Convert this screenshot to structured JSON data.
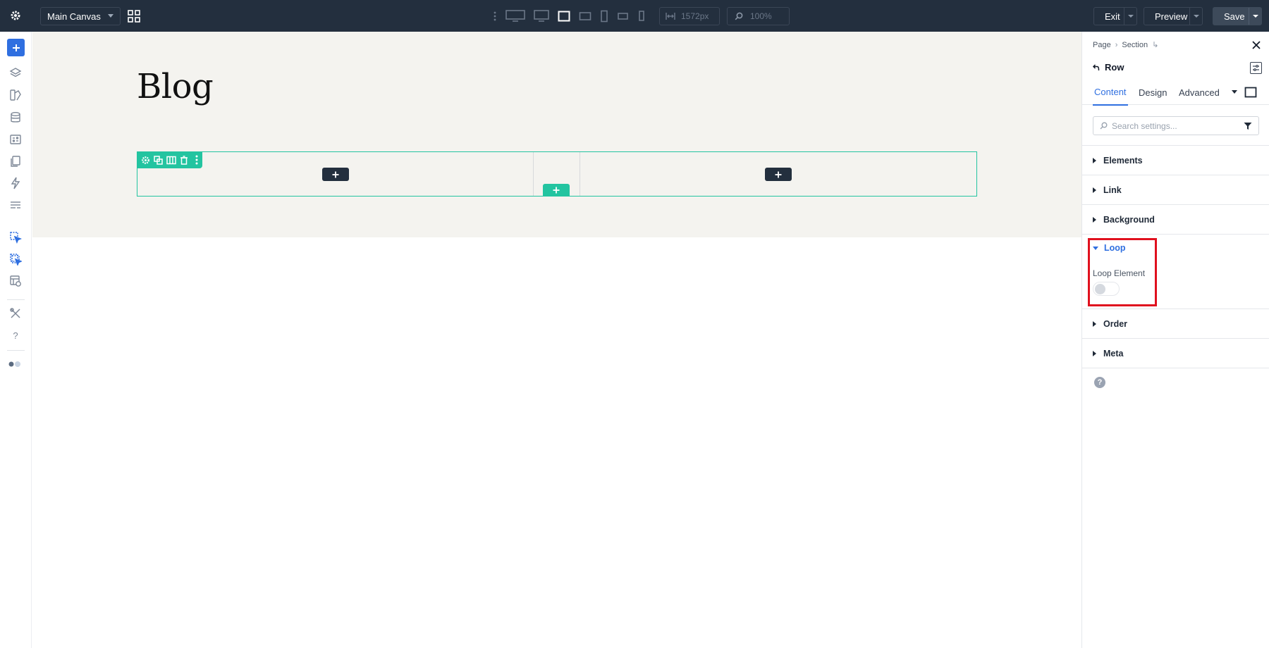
{
  "topbar": {
    "canvas_select": "Main Canvas",
    "width_value": "1572px",
    "zoom_value": "100%",
    "exit_label": "Exit",
    "preview_label": "Preview",
    "save_label": "Save"
  },
  "canvas": {
    "title": "Blog"
  },
  "panel": {
    "breadcrumb": [
      "Page",
      "Section"
    ],
    "element_label": "Row",
    "tabs": [
      "Content",
      "Design",
      "Advanced"
    ],
    "active_tab": "Content",
    "search_placeholder": "Search settings...",
    "sections": {
      "elements": "Elements",
      "link": "Link",
      "background": "Background",
      "loop": "Loop",
      "order": "Order",
      "meta": "Meta"
    },
    "loop_element_label": "Loop Element",
    "loop_element_enabled": false,
    "help_glyph": "?"
  },
  "colors": {
    "topbar_bg": "#232f3e",
    "accent": "#2f6fe0",
    "row_outline": "#23c4a0",
    "highlight": "#e0101e",
    "section_bg": "#f4f3ef"
  }
}
